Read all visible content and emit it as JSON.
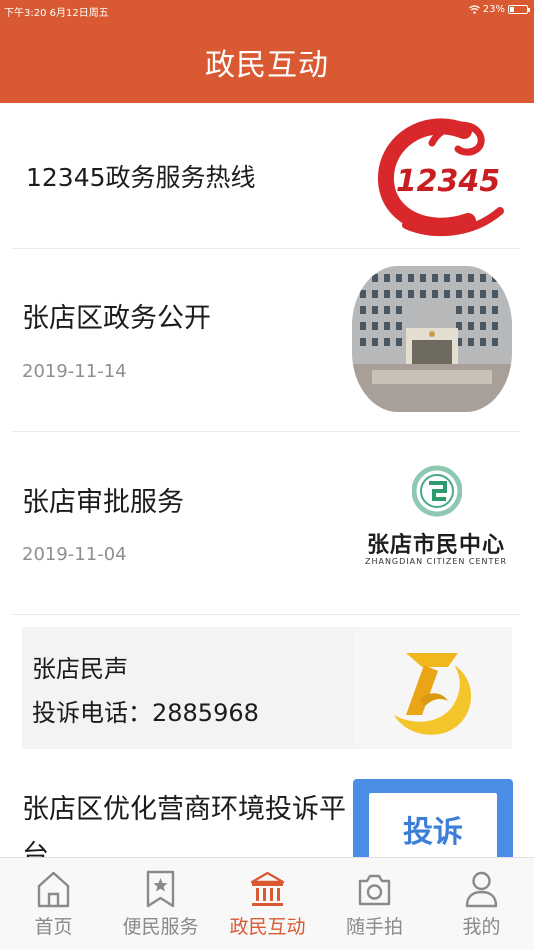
{
  "status_bar": {
    "time_date": "下午3:20  6月12日周五",
    "battery": "23%",
    "battery_level": 0.23
  },
  "header": {
    "title": "政民互动"
  },
  "items": [
    {
      "title": "12345政务服务热线",
      "thumb_icon": "hotline-12345-logo",
      "thumb_text": "12345"
    },
    {
      "title": "张店区政务公开",
      "date": "2019-11-14",
      "thumb_icon": "government-building-photo"
    },
    {
      "title": "张店审批服务",
      "date": "2019-11-04",
      "thumb_icon": "citizen-center-logo",
      "thumb_text": "张店市民中心",
      "thumb_subtext": "ZHANGDIAN CITIZEN CENTER"
    },
    {
      "line1": "张店民声",
      "line2": "投诉电话：2885968",
      "thumb_icon": "minsheng-logo"
    },
    {
      "title_line1": "张店区优化营商环境投诉平",
      "title_line2": "台",
      "thumb_icon": "complaint-badge",
      "thumb_text": "投诉"
    }
  ],
  "tabs": [
    {
      "label": "首页",
      "icon": "home-icon"
    },
    {
      "label": "便民服务",
      "icon": "bookmark-star-icon"
    },
    {
      "label": "政民互动",
      "icon": "government-icon",
      "active": true
    },
    {
      "label": "随手拍",
      "icon": "camera-icon"
    },
    {
      "label": "我的",
      "icon": "user-icon"
    }
  ],
  "colors": {
    "brand": "#d95a32",
    "tab_inactive": "#8a8a8a",
    "date_gray": "#8f8f8f"
  }
}
